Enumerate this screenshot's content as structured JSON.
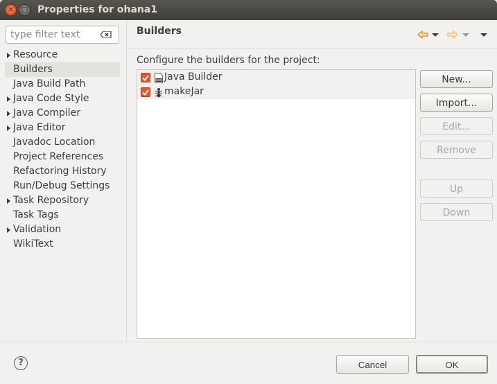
{
  "window": {
    "title": "Properties for ohana1",
    "close_glyph": "✕",
    "maximize_glyph": "□"
  },
  "filter": {
    "placeholder": "type filter text",
    "value": ""
  },
  "tree": {
    "items": [
      {
        "label": "Resource",
        "expandable": true,
        "selected": false
      },
      {
        "label": "Builders",
        "expandable": false,
        "selected": true
      },
      {
        "label": "Java Build Path",
        "expandable": false,
        "selected": false
      },
      {
        "label": "Java Code Style",
        "expandable": true,
        "selected": false
      },
      {
        "label": "Java Compiler",
        "expandable": true,
        "selected": false
      },
      {
        "label": "Java Editor",
        "expandable": true,
        "selected": false
      },
      {
        "label": "Javadoc Location",
        "expandable": false,
        "selected": false
      },
      {
        "label": "Project References",
        "expandable": false,
        "selected": false
      },
      {
        "label": "Refactoring History",
        "expandable": false,
        "selected": false
      },
      {
        "label": "Run/Debug Settings",
        "expandable": false,
        "selected": false
      },
      {
        "label": "Task Repository",
        "expandable": true,
        "selected": false
      },
      {
        "label": "Task Tags",
        "expandable": false,
        "selected": false
      },
      {
        "label": "Validation",
        "expandable": true,
        "selected": false
      },
      {
        "label": "WikiText",
        "expandable": false,
        "selected": false
      }
    ]
  },
  "page": {
    "title": "Builders",
    "configure_label": "Configure the builders for the project:",
    "builders": [
      {
        "label": "Java Builder",
        "checked": true,
        "icon": "java-builder-icon"
      },
      {
        "label": "makeJar",
        "checked": true,
        "icon": "ant-builder-icon"
      }
    ]
  },
  "buttons": {
    "new": "New...",
    "import": "Import...",
    "edit": "Edit...",
    "remove": "Remove",
    "up": "Up",
    "down": "Down"
  },
  "footer": {
    "help_glyph": "?",
    "cancel": "Cancel",
    "ok": "OK"
  },
  "colors": {
    "checkbox": "#e05a30",
    "nav_arrow": "#e8a33a",
    "title_bar": "#403f3b"
  }
}
